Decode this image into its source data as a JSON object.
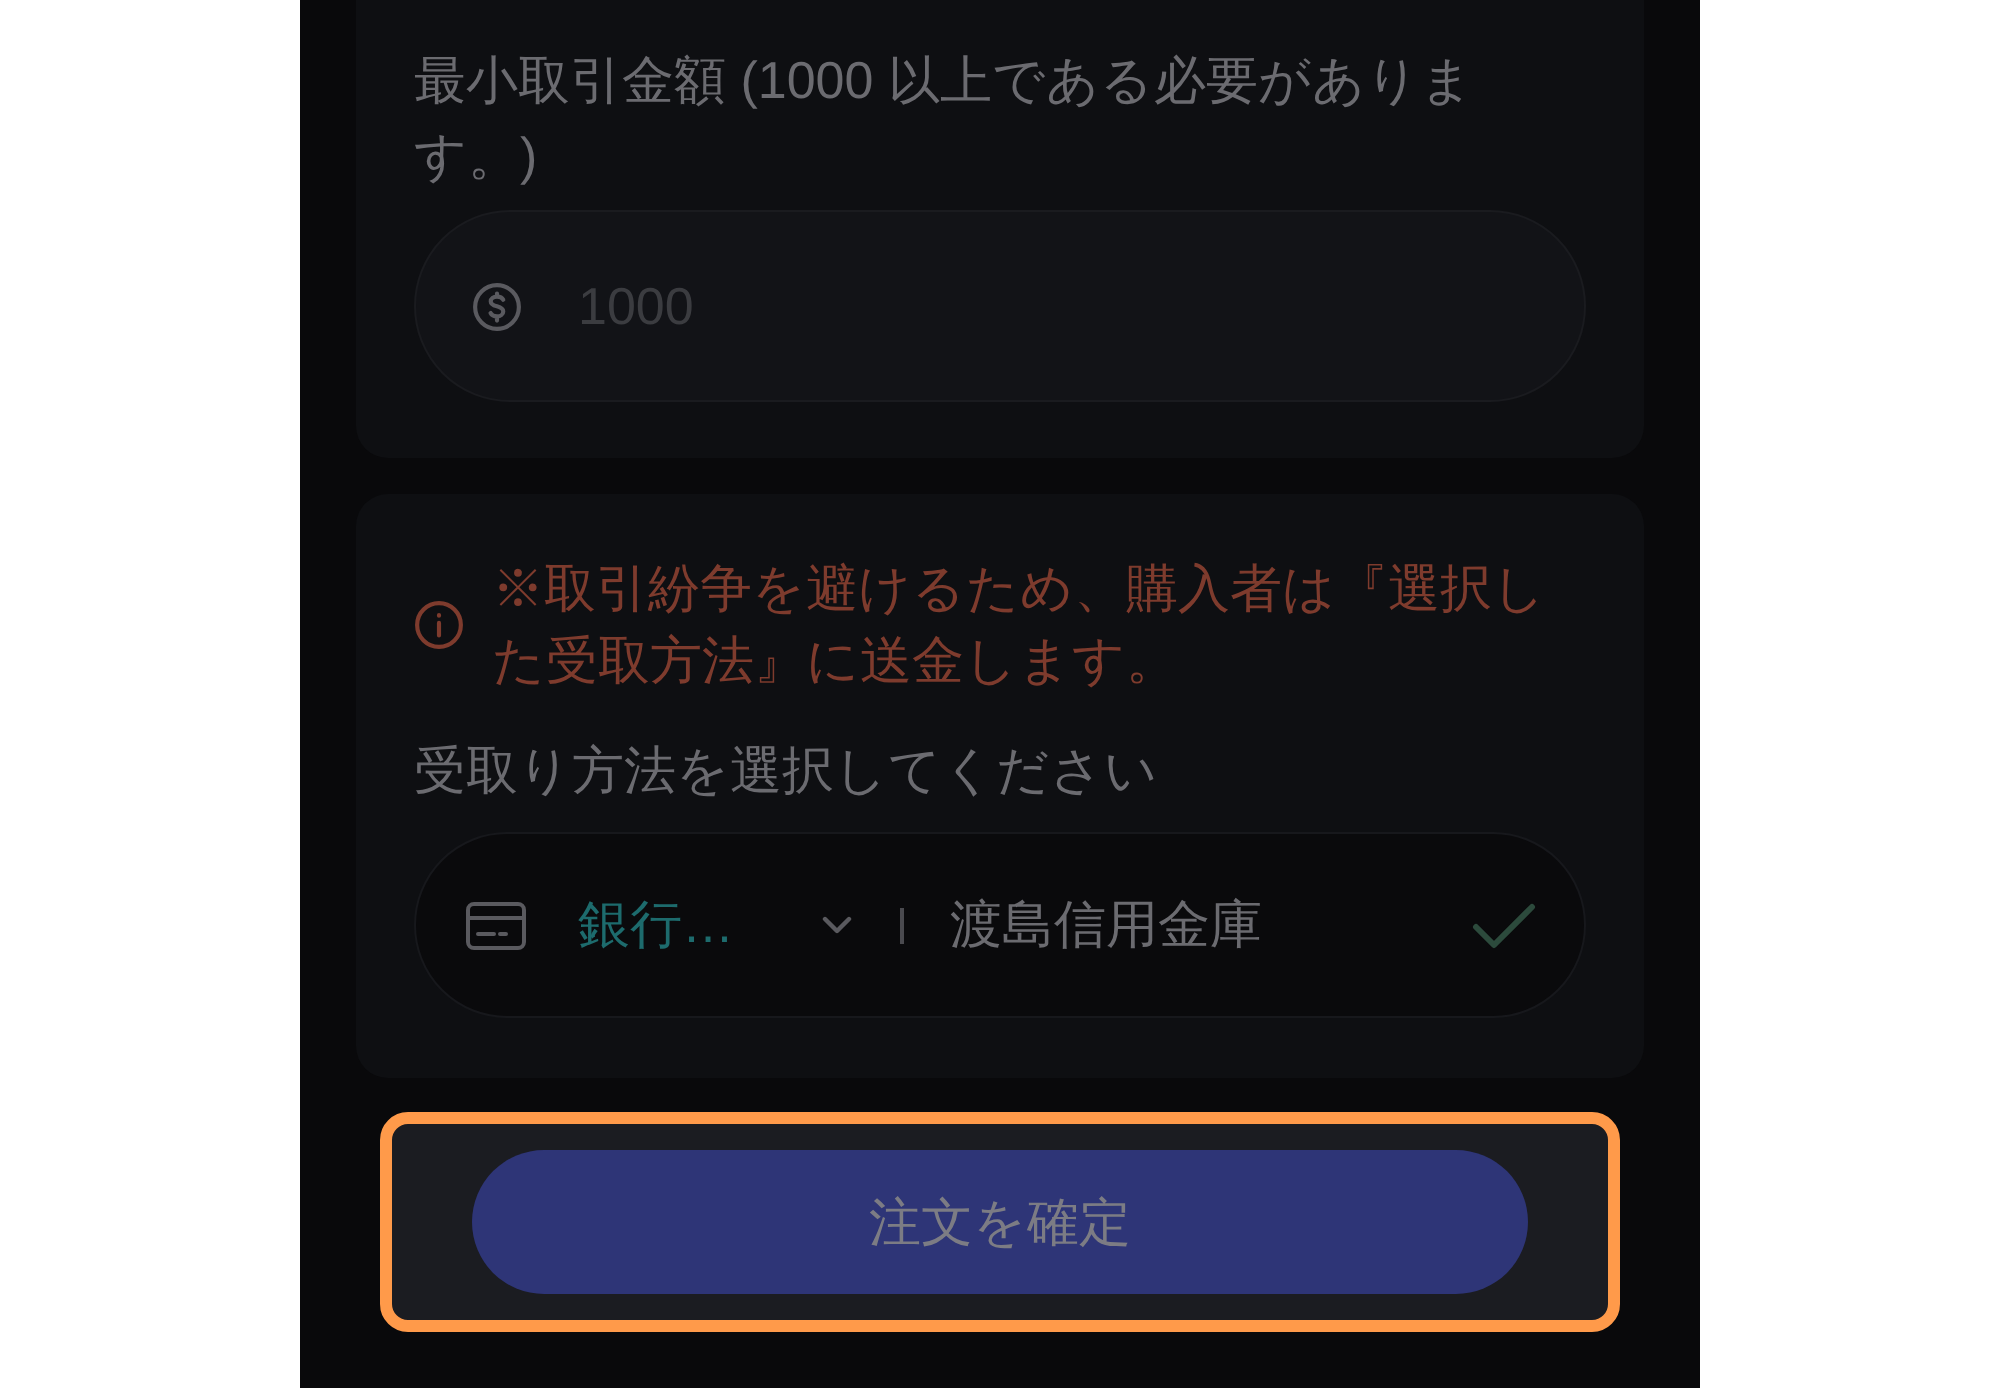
{
  "amount": {
    "label": "最小取引金額 (1000 以上である必要があります。)",
    "placeholder": "1000"
  },
  "receiving": {
    "warning": "※取引紛争を避けるため、購入者は『選択した受取方法』に送金します。",
    "label": "受取り方法を選択してください",
    "method": {
      "type": "銀行…",
      "account": "渡島信用金庫",
      "verified": true
    }
  },
  "confirm_button": {
    "label": "注文を確定",
    "highlighted": true
  }
}
